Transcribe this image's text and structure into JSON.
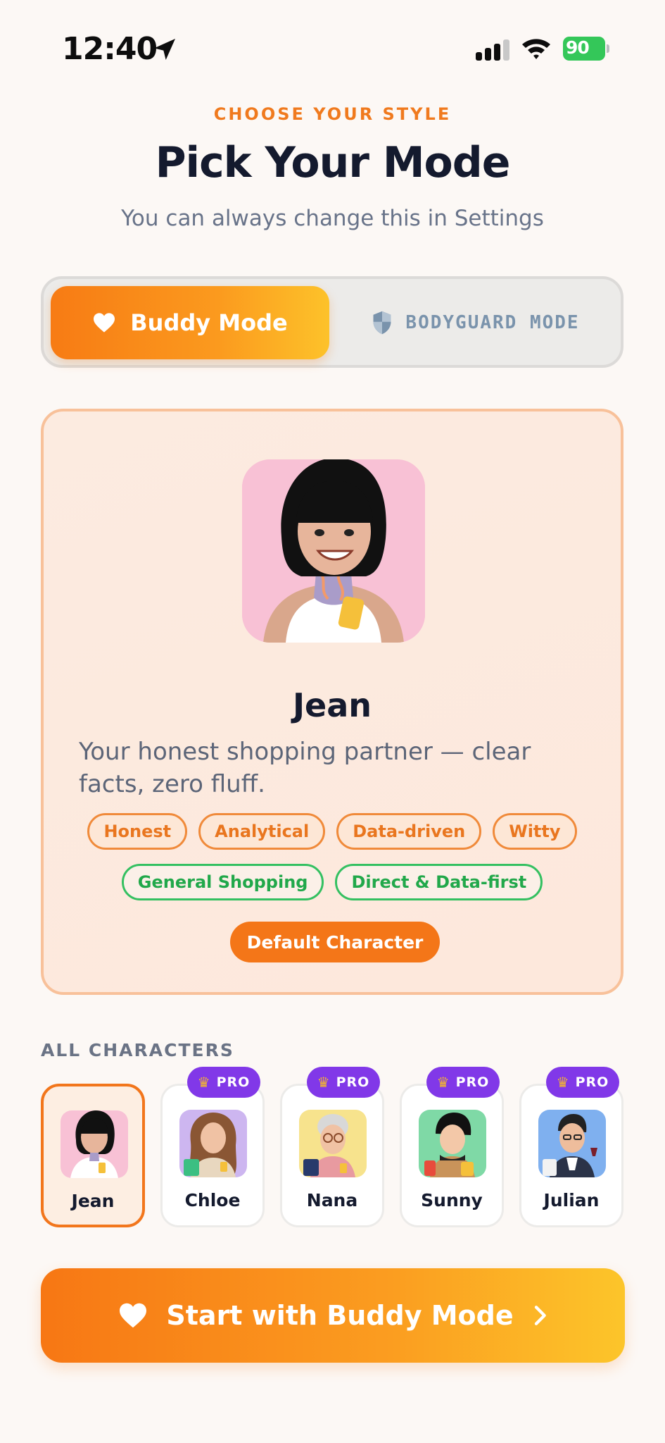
{
  "status_bar": {
    "time": "12:40",
    "battery": "90"
  },
  "header": {
    "eyebrow": "CHOOSE YOUR STYLE",
    "title": "Pick Your Mode",
    "subtitle": "You can always change this in Settings"
  },
  "mode_toggle": {
    "selected": "buddy",
    "buddy_label": "Buddy Mode",
    "bodyguard_label": "BODYGUARD MODE"
  },
  "selected_character": {
    "name": "Jean",
    "description": "Your honest shopping partner — clear facts, zero fluff.",
    "traits": [
      "Honest",
      "Analytical",
      "Data-driven",
      "Witty"
    ],
    "styles": [
      "General Shopping",
      "Direct & Data-first"
    ],
    "badge": "Default Character"
  },
  "all_characters": {
    "label": "ALL CHARACTERS",
    "items": [
      {
        "name": "Jean",
        "pro": false,
        "selected": true
      },
      {
        "name": "Chloe",
        "pro": true,
        "pro_label": "PRO"
      },
      {
        "name": "Nana",
        "pro": true,
        "pro_label": "PRO"
      },
      {
        "name": "Sunny",
        "pro": true,
        "pro_label": "PRO"
      },
      {
        "name": "Julian",
        "pro": true,
        "pro_label": "PRO"
      }
    ]
  },
  "cta": {
    "label": "Start with Buddy Mode"
  },
  "colors": {
    "accent": "#f77b14",
    "accent_end": "#fcc52a",
    "pro": "#8138e8",
    "trait": "#e9761f",
    "style": "#21a84a"
  }
}
